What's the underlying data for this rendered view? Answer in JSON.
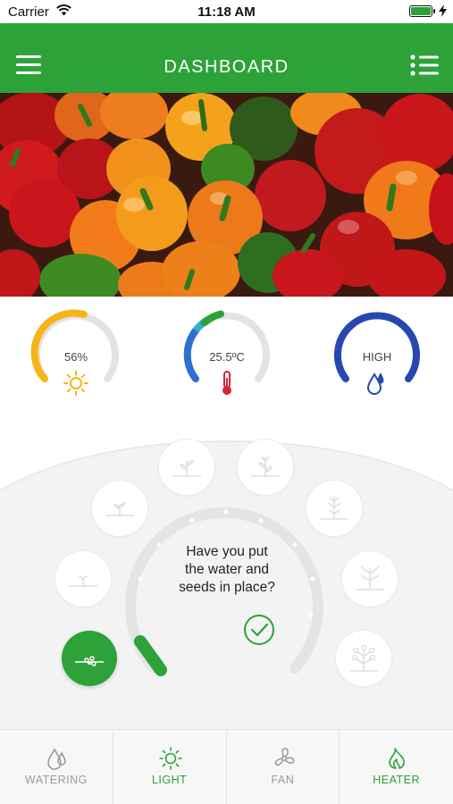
{
  "status_bar": {
    "carrier": "Carrier",
    "time": "11:18 AM",
    "icons": [
      "wifi-icon",
      "battery-icon",
      "charging-icon"
    ]
  },
  "header": {
    "title": "DASHBOARD",
    "left_icon": "hamburger-menu-icon",
    "right_icon": "list-icon",
    "background": "#2ca239"
  },
  "hero": {
    "image": "bell-peppers-photo"
  },
  "gauges": {
    "light": {
      "value": "56%",
      "level": 0.56,
      "icon": "sun-icon",
      "color": "#f6b418"
    },
    "temperature": {
      "value": "25.5ºC",
      "icon": "thermometer-icon",
      "color": "#2f6fd1"
    },
    "humidity": {
      "value": "HIGH",
      "icon": "water-drops-icon",
      "color": "#2747b0"
    }
  },
  "growth": {
    "question": [
      "Have you put",
      "the water and",
      "seeds in place?"
    ],
    "confirm_icon": "check-circle-icon",
    "stages": [
      "seed-stage-icon",
      "sprout-stage-icon",
      "seedling-stage-icon",
      "young-plant-stage-icon",
      "leafy-plant-stage-icon",
      "growing-plant-stage-icon",
      "branching-plant-stage-icon",
      "tree-stage-icon",
      "flowering-plant-stage-icon"
    ],
    "active_stage": "seed-stage-icon",
    "accent": "#2ca239"
  },
  "tabs": [
    {
      "label": "WATERING",
      "icon": "watering-drops-icon",
      "active": false
    },
    {
      "label": "LIGHT",
      "icon": "sun-icon",
      "active": true
    },
    {
      "label": "FAN",
      "icon": "fan-icon",
      "active": false
    },
    {
      "label": "HEATER",
      "icon": "flame-icon",
      "active": true
    }
  ]
}
